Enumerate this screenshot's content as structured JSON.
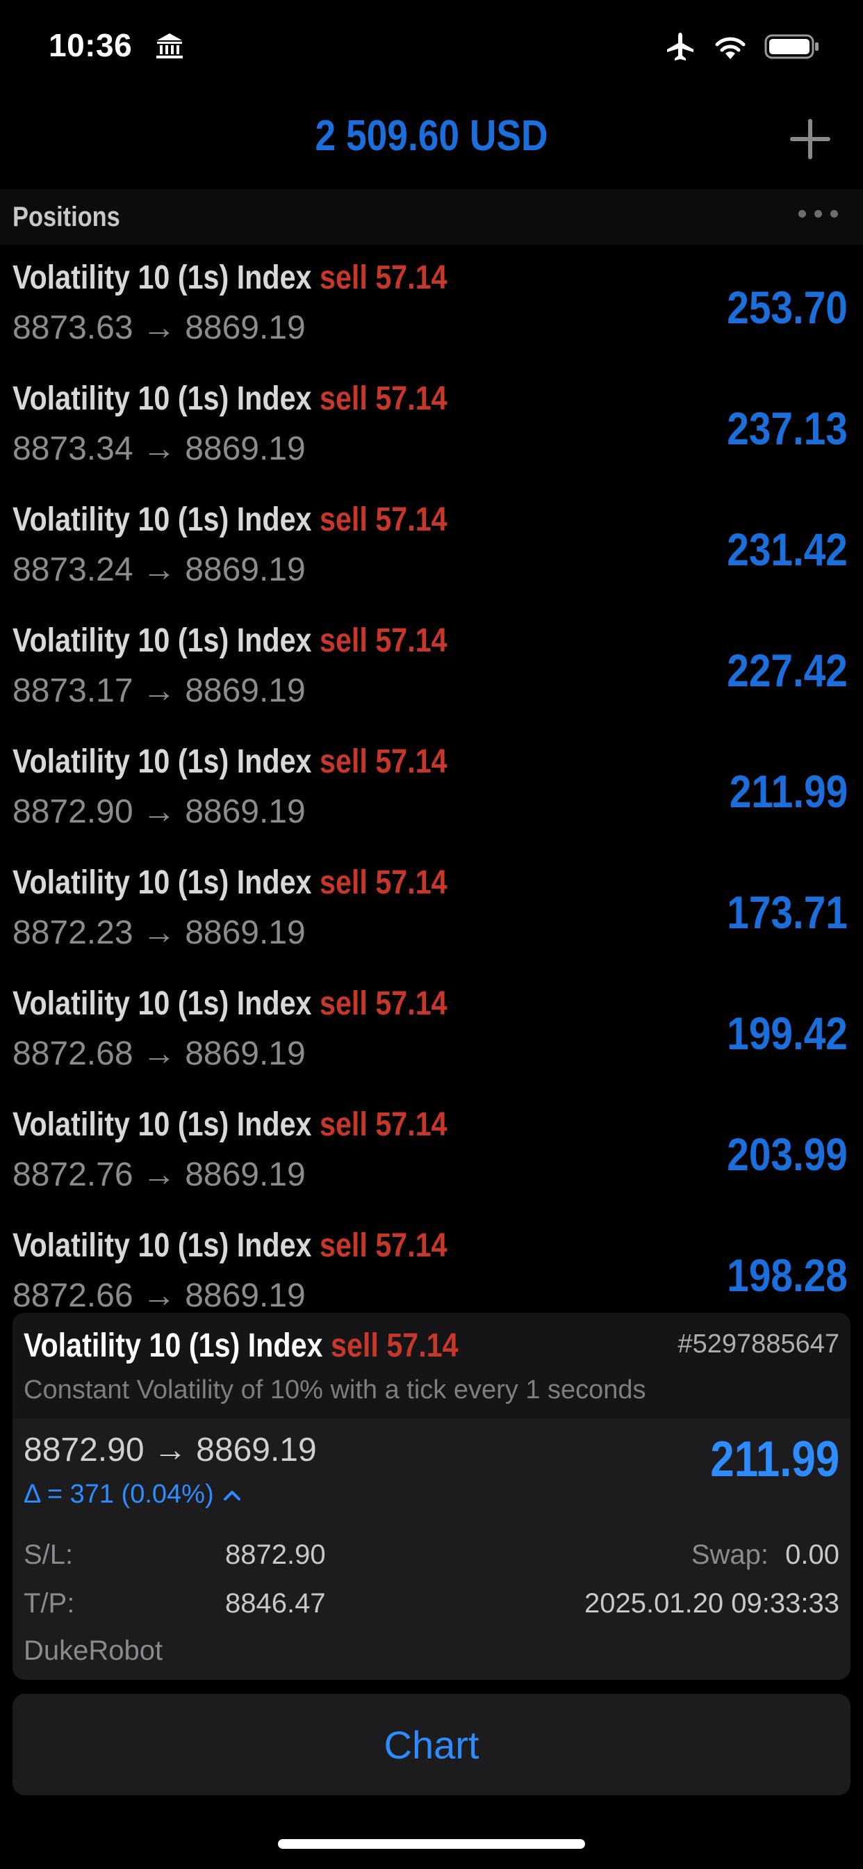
{
  "status_bar": {
    "time": "10:36"
  },
  "header": {
    "balance": "2 509.60 USD"
  },
  "positions": {
    "title": "Positions",
    "arrow": "→",
    "rows": [
      {
        "symbol": "Volatility 10 (1s) Index",
        "side": "sell 57.14",
        "open": "8873.63",
        "current": "8869.19",
        "profit": "253.70"
      },
      {
        "symbol": "Volatility 10 (1s) Index",
        "side": "sell 57.14",
        "open": "8873.34",
        "current": "8869.19",
        "profit": "237.13"
      },
      {
        "symbol": "Volatility 10 (1s) Index",
        "side": "sell 57.14",
        "open": "8873.24",
        "current": "8869.19",
        "profit": "231.42"
      },
      {
        "symbol": "Volatility 10 (1s) Index",
        "side": "sell 57.14",
        "open": "8873.17",
        "current": "8869.19",
        "profit": "227.42"
      },
      {
        "symbol": "Volatility 10 (1s) Index",
        "side": "sell 57.14",
        "open": "8872.90",
        "current": "8869.19",
        "profit": "211.99"
      },
      {
        "symbol": "Volatility 10 (1s) Index",
        "side": "sell 57.14",
        "open": "8872.23",
        "current": "8869.19",
        "profit": "173.71"
      },
      {
        "symbol": "Volatility 10 (1s) Index",
        "side": "sell 57.14",
        "open": "8872.68",
        "current": "8869.19",
        "profit": "199.42"
      },
      {
        "symbol": "Volatility 10 (1s) Index",
        "side": "sell 57.14",
        "open": "8872.76",
        "current": "8869.19",
        "profit": "203.99"
      },
      {
        "symbol": "Volatility 10 (1s) Index",
        "side": "sell 57.14",
        "open": "8872.66",
        "current": "8869.19",
        "profit": "198.28"
      }
    ]
  },
  "detail": {
    "symbol": "Volatility 10 (1s) Index",
    "side": "sell 57.14",
    "ticket": "#5297885647",
    "description": "Constant Volatility of 10% with a tick every 1 seconds",
    "prices": "8872.90 → 8869.19",
    "profit": "211.99",
    "delta": "Δ = 371 (0.04%)",
    "sl_label": "S/L:",
    "sl_value": "8872.90",
    "tp_label": "T/P:",
    "tp_value": "8846.47",
    "swap_label": "Swap:",
    "swap_value": "0.00",
    "time": "2025.01.20 09:33:33",
    "comment": "DukeRobot"
  },
  "actions": {
    "chart_label": "Chart"
  },
  "colors": {
    "accent": "#2d8cff",
    "profit": "#1a6fdc",
    "sell": "#c9372b"
  }
}
